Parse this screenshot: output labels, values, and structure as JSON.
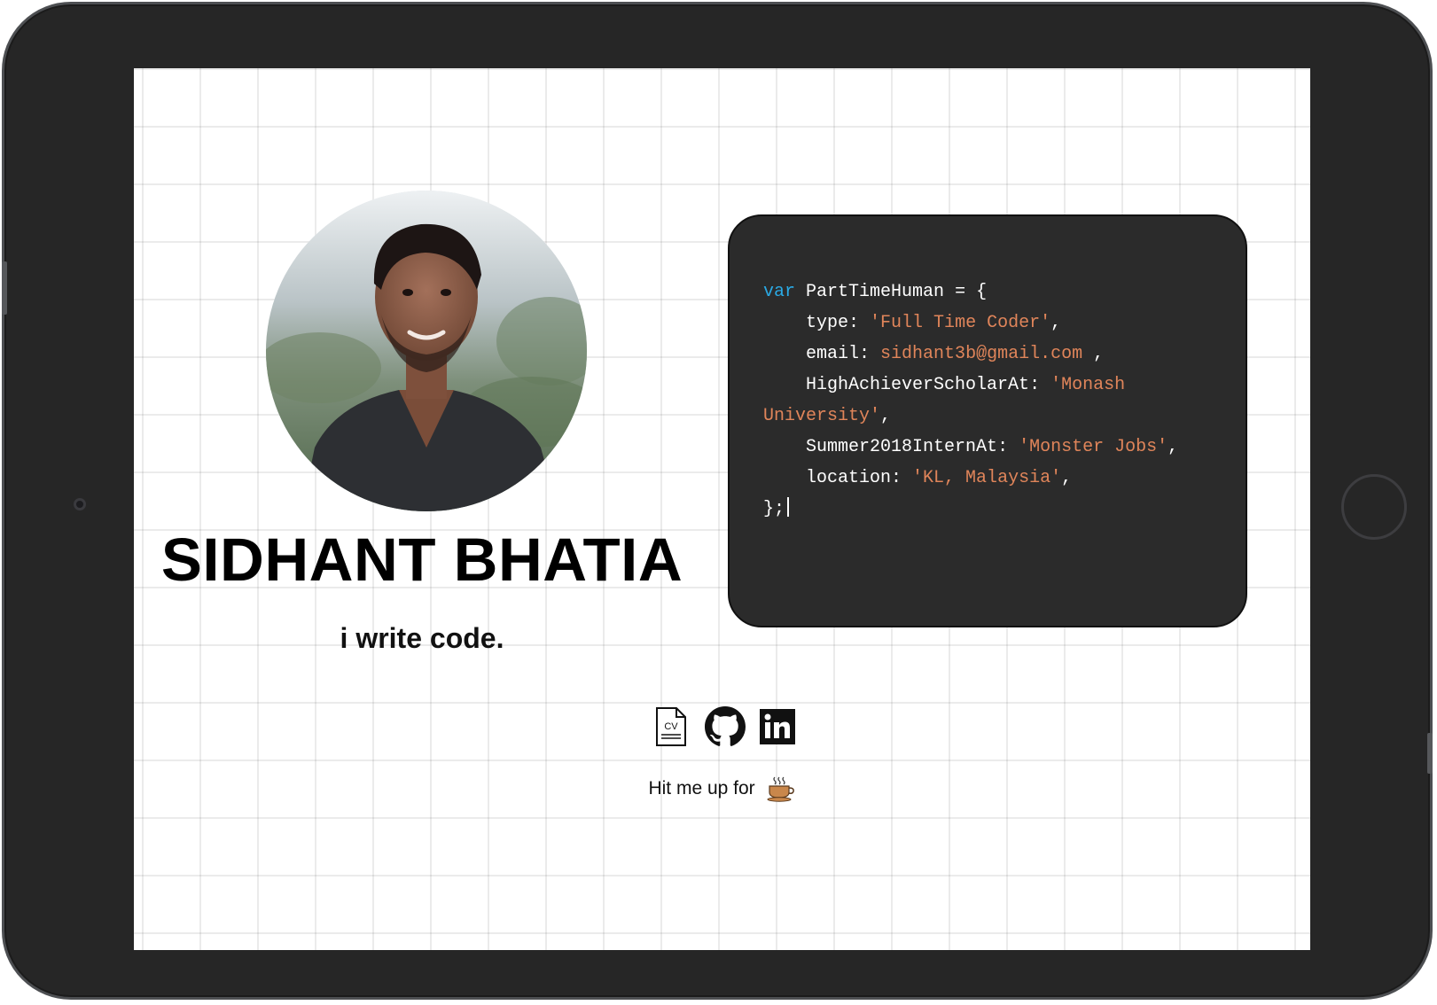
{
  "profile": {
    "name": "SIDHANT BHATIA",
    "tagline": "i write code."
  },
  "code": {
    "keyword": "var",
    "variable": "PartTimeHuman",
    "open": " = {",
    "close": "};",
    "lines": [
      {
        "key": "type",
        "value": "'Full Time Coder'",
        "suffix": ","
      },
      {
        "key": "email",
        "value": "sidhant3b@gmail.com",
        "suffix": " ,"
      },
      {
        "key": "HighAchieverScholarAt",
        "value": "'Monash",
        "suffix": ""
      },
      {
        "continuation": "University'",
        "suffix": ","
      },
      {
        "key": "Summer2018InternAt",
        "value": "'Monster Jobs'",
        "suffix": ","
      },
      {
        "key": "location",
        "value": "'KL, Malaysia'",
        "suffix": ","
      }
    ]
  },
  "social": {
    "cv_label": "CV",
    "icons": [
      "cv-document-icon",
      "github-icon",
      "linkedin-icon"
    ]
  },
  "footer": {
    "text": "Hit me up for",
    "icon": "coffee-cup-icon"
  },
  "colors": {
    "keyword": "#2aa9e4",
    "string": "#e0855a",
    "card_bg": "#2b2b2b",
    "device_frame": "#262626"
  }
}
